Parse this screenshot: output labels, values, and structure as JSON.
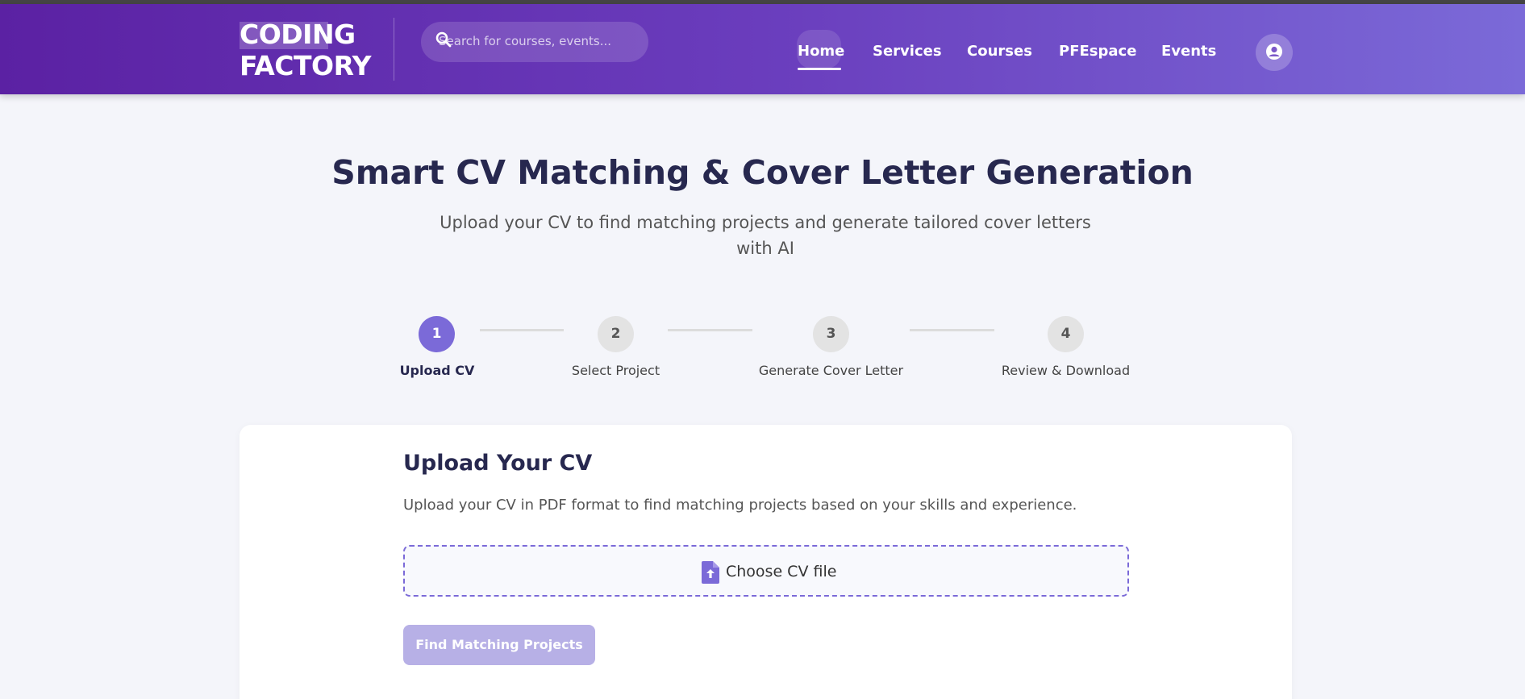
{
  "header": {
    "logo_line1": "CODING",
    "logo_line2": "FACTORY",
    "search_placeholder": "Search for courses, events...",
    "nav": [
      "Home",
      "Services",
      "Courses",
      "PFEspace",
      "Events"
    ],
    "active_nav": "Home"
  },
  "page": {
    "title": "Smart CV Matching & Cover Letter Generation",
    "subtitle_line1": "Upload your CV to find matching projects and generate tailored cover letters",
    "subtitle_line2": "with AI"
  },
  "steps": [
    {
      "number": "1",
      "label": "Upload CV",
      "active": true
    },
    {
      "number": "2",
      "label": "Select Project",
      "active": false
    },
    {
      "number": "3",
      "label": "Generate Cover Letter",
      "active": false
    },
    {
      "number": "4",
      "label": "Review & Download",
      "active": false
    }
  ],
  "upload": {
    "title": "Upload Your CV",
    "description": "Upload your CV in PDF format to find matching projects based on your skills and experience.",
    "choose_label": "Choose CV file",
    "button_label": "Find Matching Projects"
  },
  "icons": {
    "search": "search-icon",
    "user": "user-icon",
    "file_upload": "file-upload-icon"
  },
  "colors": {
    "accent": "#7b6ad8",
    "header_start": "#5b21a3",
    "header_end": "#7b6ad8",
    "title": "#27284f",
    "disabled_button": "#b7b0e6"
  }
}
